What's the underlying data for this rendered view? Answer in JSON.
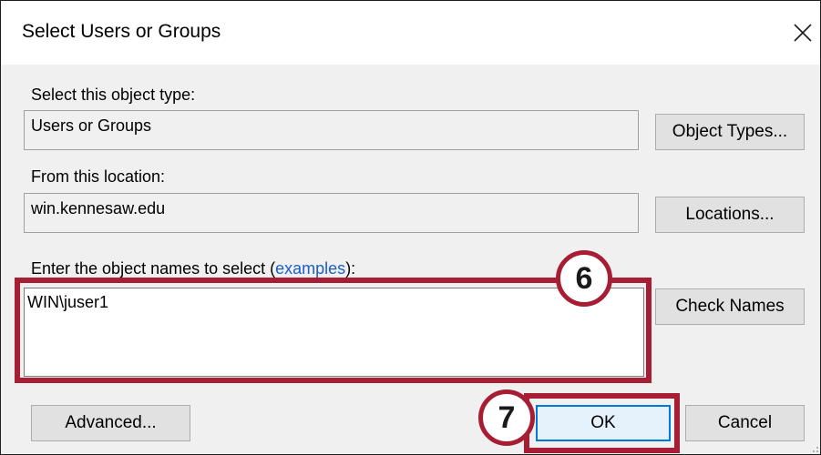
{
  "dialog": {
    "title": "Select Users or Groups",
    "close_icon": "close-icon"
  },
  "object_type": {
    "label": "Select this object type:",
    "value": "Users or Groups",
    "button_label": "Object Types..."
  },
  "location": {
    "label": "From this location:",
    "value": "win.kennesaw.edu",
    "button_label": "Locations..."
  },
  "object_names": {
    "label": "Enter the object names to select (",
    "link_label": "examples",
    "label_suffix": "):",
    "value": "WIN\\juser1",
    "check_names_label": "Check Names"
  },
  "footer": {
    "advanced_label": "Advanced...",
    "ok_label": "OK",
    "cancel_label": "Cancel"
  },
  "annotations": {
    "step_6": "6",
    "step_7": "7",
    "highlight_color": "#a71e34"
  },
  "colors": {
    "dialog_background": "#f0f0f0",
    "default_button_border": "#0078d7",
    "link": "#1a5fc8"
  }
}
